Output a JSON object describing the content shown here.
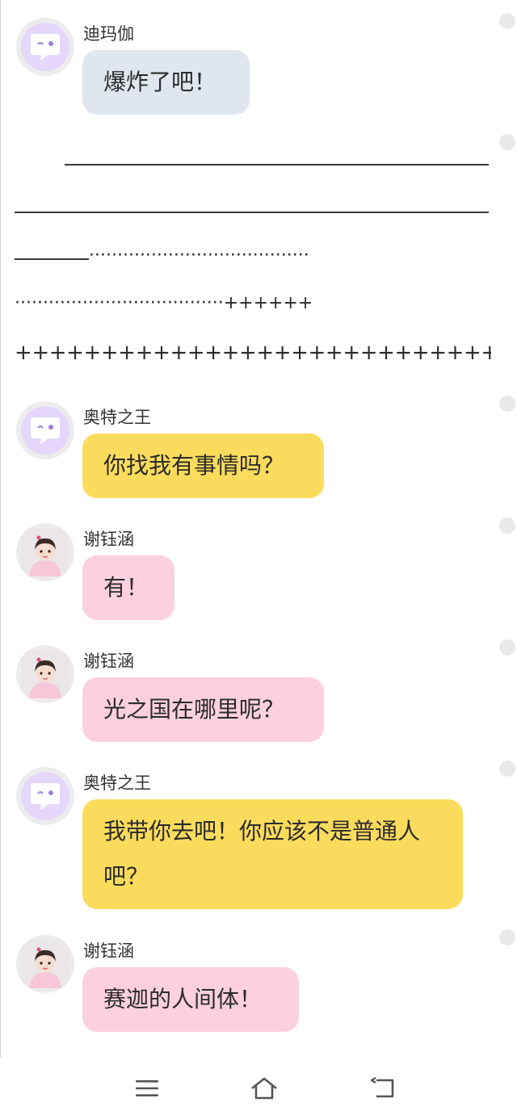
{
  "messages": [
    {
      "sender": "迪玛伽",
      "avatar": "speech-bubble-logo",
      "bubble_color": "#dfe6ee",
      "text": "爆炸了吧！"
    },
    {
      "sender": "奥特之王",
      "avatar": "speech-bubble-logo",
      "bubble_color": "#fbdb5c",
      "text": "你找我有事情吗？"
    },
    {
      "sender": "谢钰涵",
      "avatar": "girl-photo",
      "bubble_color": "#fdd0e0",
      "text": "有！"
    },
    {
      "sender": "谢钰涵",
      "avatar": "girl-photo",
      "bubble_color": "#fdd0e0",
      "text": "光之国在哪里呢？"
    },
    {
      "sender": "奥特之王",
      "avatar": "speech-bubble-logo",
      "bubble_color": "#fbdb5c",
      "text": "我带你去吧！你应该不是普通人吧？"
    },
    {
      "sender": "谢钰涵",
      "avatar": "girl-photo",
      "bubble_color": "#fdd0e0",
      "text": "赛迦的人间体！"
    }
  ],
  "separator": {
    "dots_line_1": "·······································",
    "dots_line_2": "·····································++++++",
    "plus_line": "+++++++++++++++++++++++++++++++"
  },
  "navbar": {
    "icons": [
      "menu-icon",
      "home-icon",
      "back-icon"
    ]
  }
}
